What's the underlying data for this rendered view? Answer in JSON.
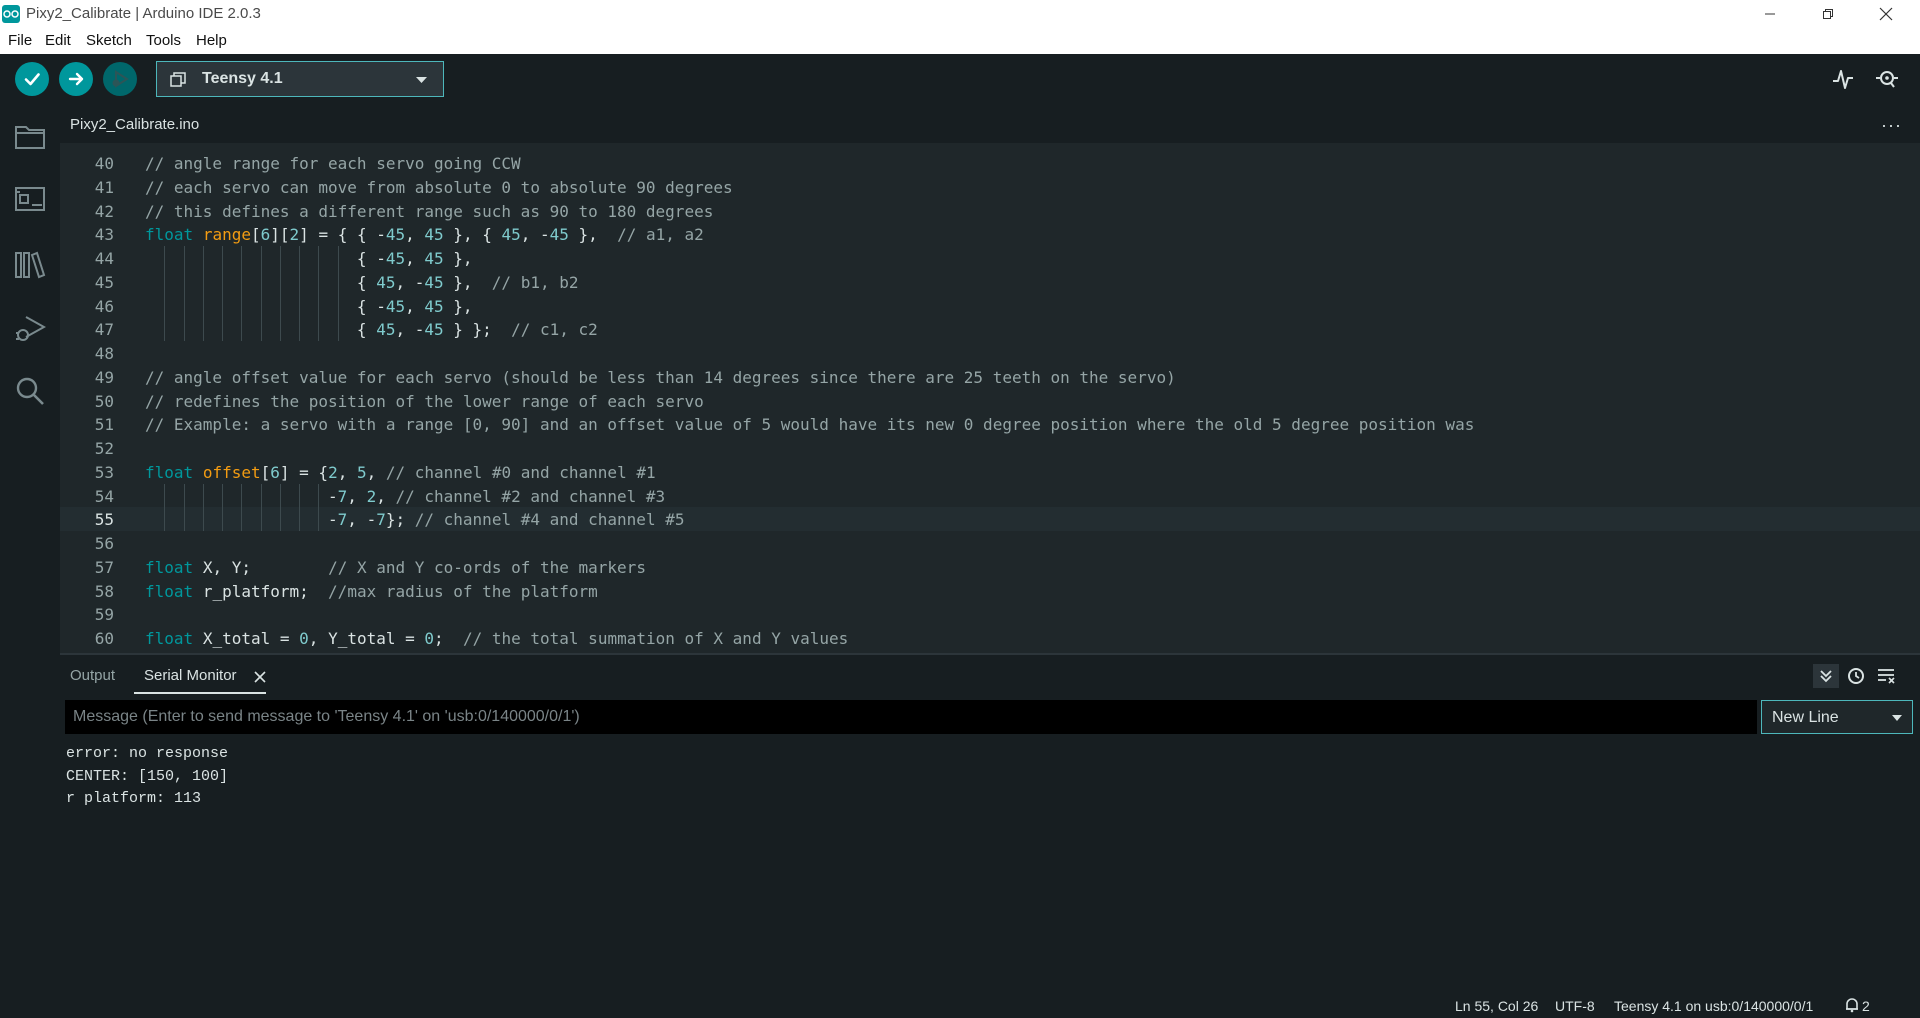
{
  "window": {
    "title": "Pixy2_Calibrate | Arduino IDE 2.0.3"
  },
  "menu": [
    "File",
    "Edit",
    "Sketch",
    "Tools",
    "Help"
  ],
  "toolbar": {
    "board": "Teensy 4.1"
  },
  "tab": {
    "filename": "Pixy2_Calibrate.ino"
  },
  "editor": {
    "current_line": 55,
    "lines": [
      {
        "n": "40",
        "t": "// angle range for each servo going CCW"
      },
      {
        "n": "41",
        "t": "// each servo can move from absolute 0 to absolute 90 degrees"
      },
      {
        "n": "42",
        "t": "// this defines a different range such as 90 to 180 degrees"
      },
      {
        "n": "43",
        "t": "float range[6][2] = { { -45, 45 }, { 45, -45 },  // a1, a2"
      },
      {
        "n": "44",
        "t": "                      { -45, 45 },"
      },
      {
        "n": "45",
        "t": "                      { 45, -45 },  // b1, b2"
      },
      {
        "n": "46",
        "t": "                      { -45, 45 },"
      },
      {
        "n": "47",
        "t": "                      { 45, -45 } };  // c1, c2"
      },
      {
        "n": "48",
        "t": ""
      },
      {
        "n": "49",
        "t": "// angle offset value for each servo (should be less than 14 degrees since there are 25 teeth on the servo)"
      },
      {
        "n": "50",
        "t": "// redefines the position of the lower range of each servo"
      },
      {
        "n": "51",
        "t": "// Example: a servo with a range [0, 90] and an offset value of 5 would have its new 0 degree position where the old 5 degree position was"
      },
      {
        "n": "52",
        "t": ""
      },
      {
        "n": "53",
        "t": "float offset[6] = {2, 5, // channel #0 and channel #1"
      },
      {
        "n": "54",
        "t": "                   -7, 2, // channel #2 and channel #3"
      },
      {
        "n": "55",
        "t": "                   -7, -7}; // channel #4 and channel #5"
      },
      {
        "n": "56",
        "t": ""
      },
      {
        "n": "57",
        "t": "float X, Y;        // X and Y co-ords of the markers"
      },
      {
        "n": "58",
        "t": "float r_platform;  //max radius of the platform"
      },
      {
        "n": "59",
        "t": ""
      },
      {
        "n": "60",
        "t": "float X_total = 0, Y_total = 0;  // the total summation of X and Y values"
      }
    ]
  },
  "bottom_panel": {
    "tab_output": "Output",
    "tab_serial": "Serial Monitor",
    "message_placeholder": "Message (Enter to send message to 'Teensy 4.1' on 'usb:0/140000/0/1')",
    "line_ending": "New Line",
    "serial_output": [
      "error: no response",
      "CENTER: [150, 100]",
      "r platform: 113"
    ]
  },
  "status": {
    "position": "Ln 55, Col 26",
    "encoding": "UTF-8",
    "board": "Teensy 4.1 on usb:0/140000/0/1",
    "notifications": "2"
  },
  "colors": {
    "accent": "#00979c",
    "background": "#171e21",
    "editor_bg": "#1f272a",
    "keyword": "#00979c",
    "function": "#f39c12",
    "number": "#7fcbcd",
    "comment": "#95a5a6"
  }
}
